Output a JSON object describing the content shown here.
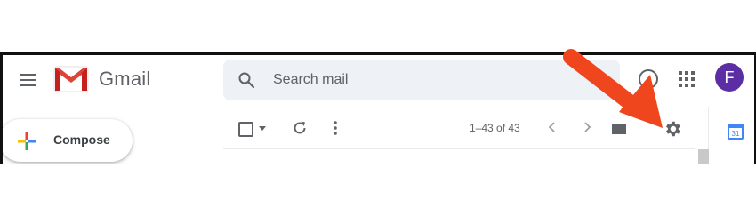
{
  "app": {
    "brand": "Gmail"
  },
  "header": {
    "search_placeholder": "Search mail",
    "avatar_initial": "F"
  },
  "compose": {
    "label": "Compose"
  },
  "toolbar": {
    "page_range": "1–43 of 43"
  },
  "calendar": {
    "day": "31"
  },
  "colors": {
    "avatar": "#5b2fa3",
    "annotation_arrow": "#f0461e",
    "gmail_red": "#db4437"
  },
  "icons": [
    "menu-icon",
    "gmail-logo-icon",
    "search-icon",
    "help-icon",
    "apps-grid-icon",
    "plus-icon",
    "select-checkbox-icon",
    "refresh-icon",
    "more-vert-icon",
    "chevron-left-icon",
    "chevron-right-icon",
    "view-toggle-icon",
    "gear-icon",
    "calendar-icon",
    "annotation-arrow"
  ]
}
